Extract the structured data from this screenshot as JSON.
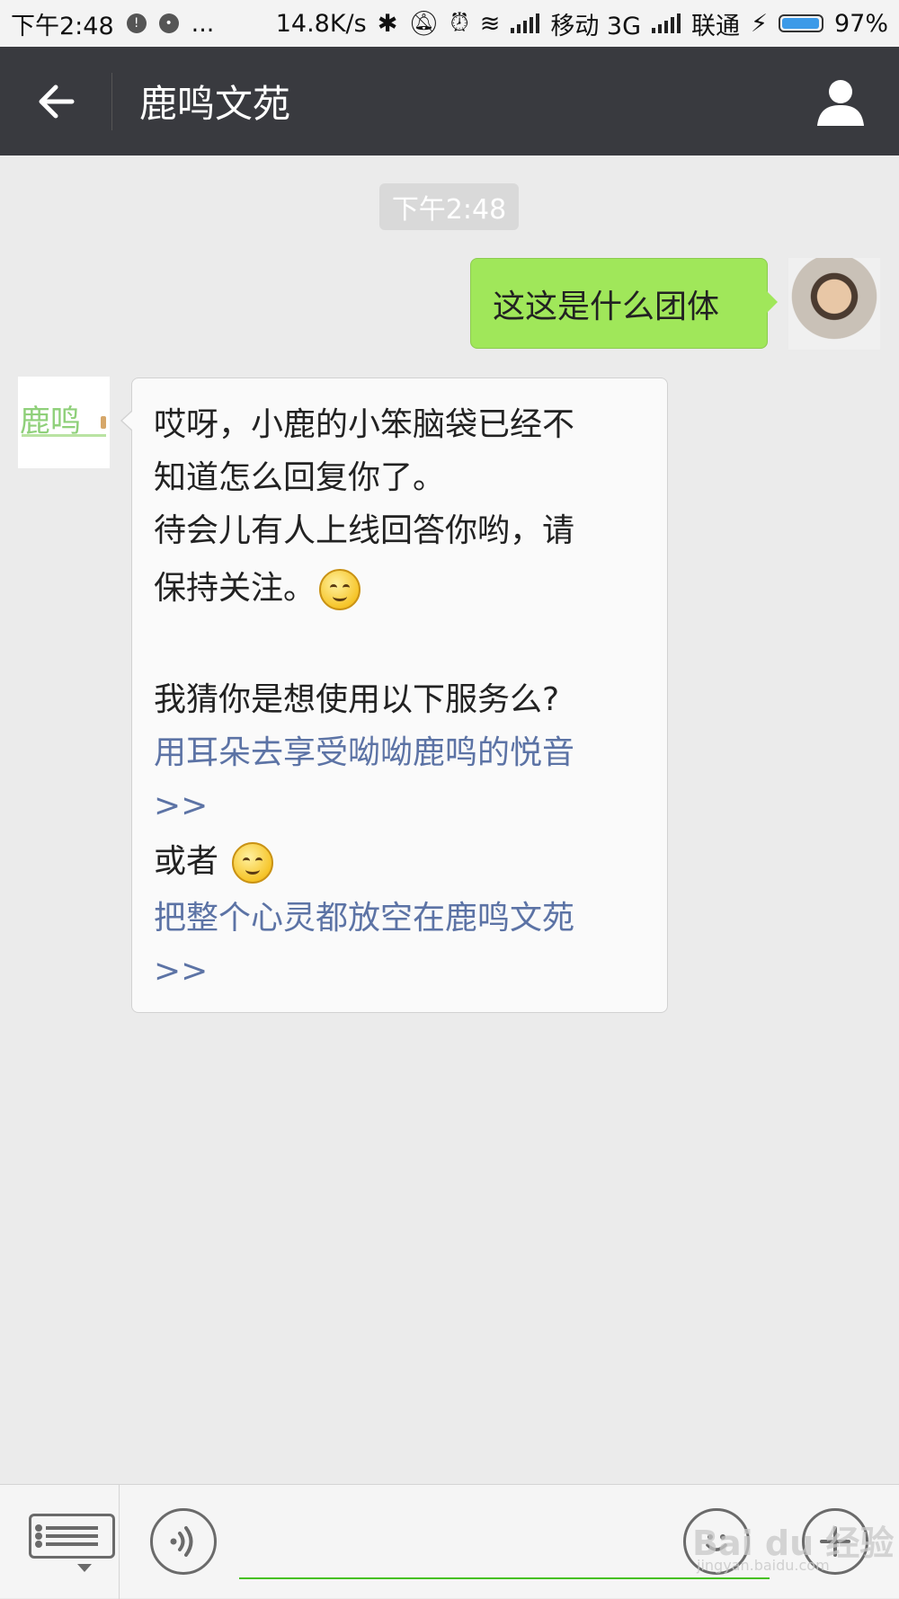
{
  "status_bar": {
    "time": "下午2:48",
    "more": "...",
    "net_speed": "14.8K/s",
    "carrier1": "移动 3G",
    "carrier2": "联通",
    "battery": "97%",
    "battery_level": 0.97
  },
  "header": {
    "title": "鹿鸣文苑"
  },
  "chat": {
    "timestamp": "下午2:48",
    "messages": [
      {
        "sender": "me",
        "text": "这这是什么团体"
      },
      {
        "sender": "bot",
        "avatar_text": "鹿鸣",
        "lines": [
          "哎呀，小鹿的小笨脑袋已经不",
          "知道怎么回复你了。",
          "待会儿有人上线回答你哟，请",
          "保持关注。",
          "",
          "我猜你是想使用以下服务么?",
          "或者"
        ],
        "links": [
          "用耳朵去享受呦呦鹿鸣的悦音",
          ">>",
          "把整个心灵都放空在鹿鸣文苑",
          ">>"
        ]
      }
    ]
  },
  "input_bar": {
    "watermark": "Bai du 经验",
    "watermark_sub": "jingyan.baidu.com"
  },
  "colors": {
    "title_bar": "#393a3f",
    "my_bubble": "#a0e75a",
    "link": "#5c73a5",
    "input_underline": "#45c01a"
  }
}
